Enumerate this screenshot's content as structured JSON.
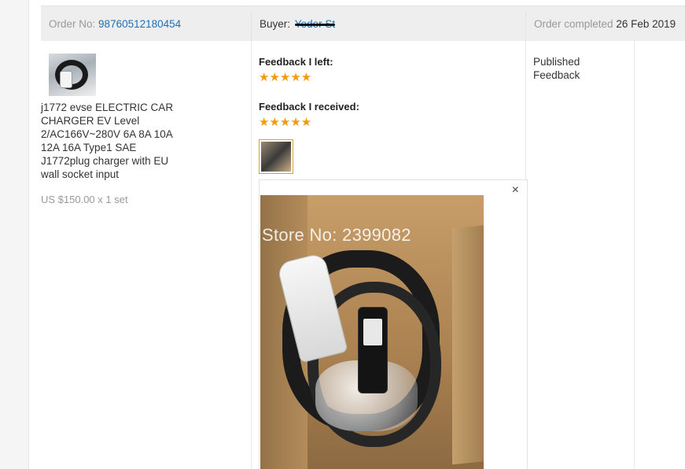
{
  "order": {
    "order_no_label": "Order No:",
    "order_no_value": "98760512180454",
    "buyer_label": "Buyer:",
    "buyer_value": "Yeder St",
    "status_label": "Order completed",
    "status_date": "26 Feb 2019"
  },
  "product": {
    "title": "j1772 evse ELECTRIC CAR CHARGER EV Level 2/AC166V~280V 6A 8A 10A 12A 16A Type1 SAE J1772plug charger with EU wall socket input",
    "price": "US $150.00 x 1 set"
  },
  "feedback": {
    "left_label": "Feedback I left:",
    "left_stars": "★★★★★",
    "received_label": "Feedback I received:",
    "received_stars": "★★★★★",
    "star_color": "#f29b0b"
  },
  "preview": {
    "close_glyph": "×",
    "watermark": "Store No: 2399082"
  },
  "status_text": "Published Feedback",
  "colors": {
    "link": "#1f6fb2",
    "muted": "#999999",
    "header_bg": "#eeeeee"
  }
}
